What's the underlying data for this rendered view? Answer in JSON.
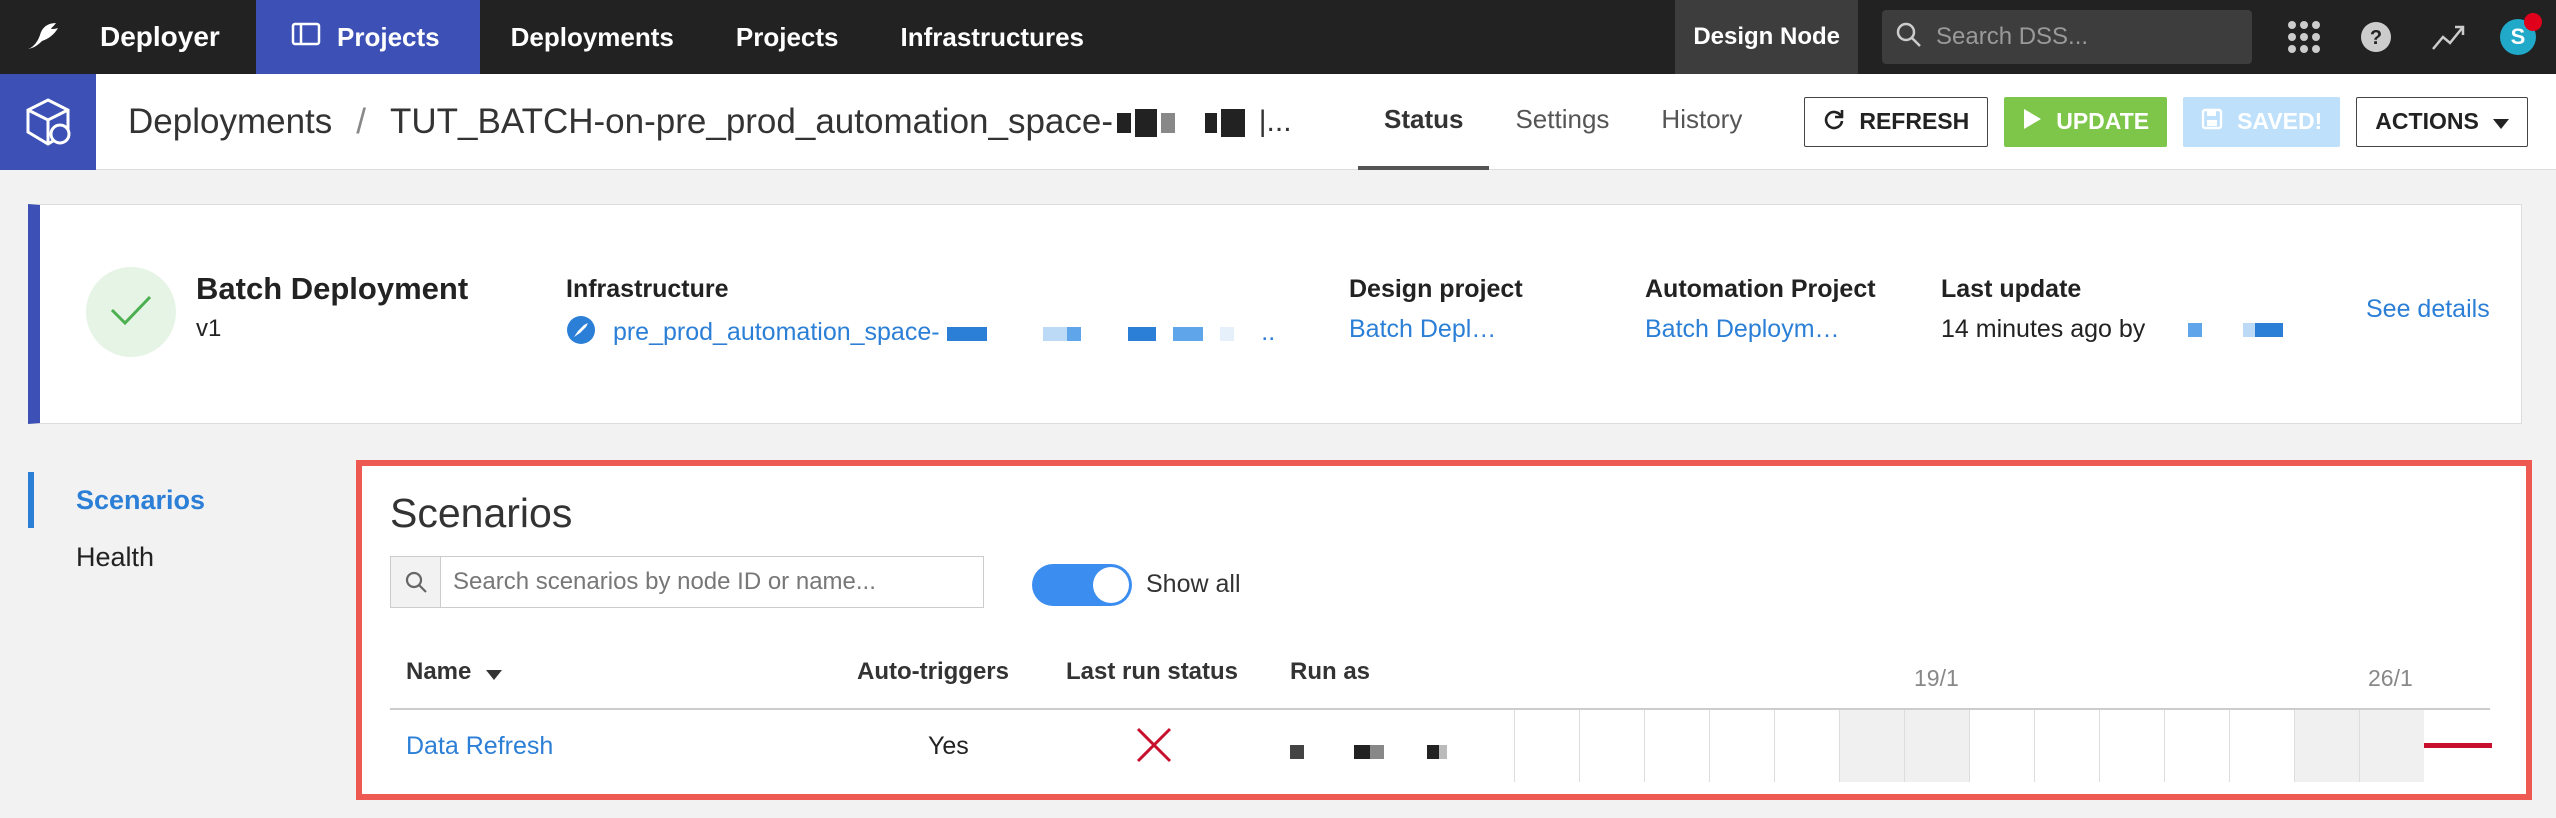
{
  "topnav": {
    "app_name": "Deployer",
    "items": [
      {
        "label": "Projects",
        "active": true
      },
      {
        "label": "Deployments",
        "active": false
      },
      {
        "label": "Projects",
        "active": false
      },
      {
        "label": "Infrastructures",
        "active": false
      }
    ],
    "node_label": "Design Node",
    "search_placeholder": "Search DSS...",
    "avatar_initial": "S"
  },
  "header": {
    "breadcrumb_root": "Deployments",
    "breadcrumb_separator": "/",
    "deployment_name": "TUT_BATCH-on-pre_prod_automation_space-",
    "ellipsis": "|...",
    "tabs": [
      {
        "label": "Status",
        "active": true
      },
      {
        "label": "Settings",
        "active": false
      },
      {
        "label": "History",
        "active": false
      }
    ],
    "refresh_label": "REFRESH",
    "update_label": "UPDATE",
    "saved_label": "SAVED!",
    "actions_label": "ACTIONS"
  },
  "summary": {
    "title": "Batch Deployment",
    "version": "v1",
    "infrastructure_label": "Infrastructure",
    "infrastructure_value": "pre_prod_automation_space-",
    "infrastructure_suffix": "..",
    "design_project_label": "Design project",
    "design_project_value": "Batch Depl…",
    "automation_project_label": "Automation Project",
    "automation_project_value": "Batch Deploym…",
    "last_update_label": "Last update",
    "last_update_value": "14 minutes ago by",
    "see_details": "See details"
  },
  "sidenav": {
    "items": [
      {
        "label": "Scenarios",
        "active": true
      },
      {
        "label": "Health",
        "active": false
      }
    ]
  },
  "scenarios": {
    "title": "Scenarios",
    "search_placeholder": "Search scenarios by node ID or name...",
    "show_all_label": "Show all",
    "columns": {
      "name": "Name",
      "auto_triggers": "Auto-triggers",
      "last_run_status": "Last run status",
      "run_as": "Run as"
    },
    "timeline_dates": [
      "19/1",
      "26/1"
    ],
    "rows": [
      {
        "name": "Data Refresh",
        "auto_triggers": "Yes"
      }
    ]
  },
  "colors": {
    "accent": "#3c50b5",
    "link": "#2b7fd6",
    "success": "#7dc649",
    "highlight": "#ee5a52",
    "failure": "#c8102e"
  }
}
